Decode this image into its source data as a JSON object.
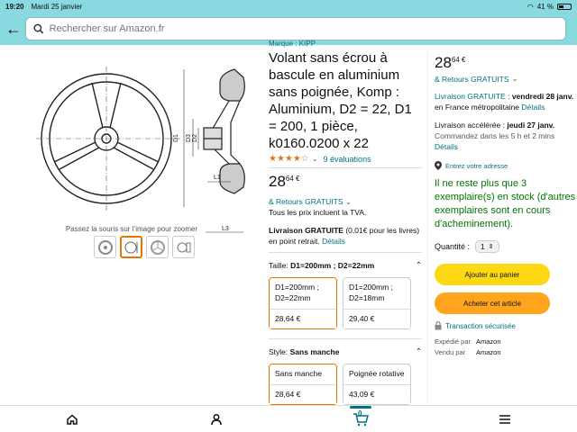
{
  "status": {
    "time": "19:20",
    "date": "Mardi 25 janvier",
    "battery": "41 %"
  },
  "search": {
    "placeholder": "Rechercher sur Amazon.fr"
  },
  "gallery": {
    "hint": "Passez la souris sur l’image pour zoomer",
    "drawing_labels": {
      "d1": "D1",
      "d2": "D2",
      "d3": "D3",
      "l1": "L1",
      "l3": "L3",
      "h7": "H7"
    }
  },
  "product": {
    "brand": "Marque : KIPP",
    "title": "Volant sans écrou à bascule en aluminium sans poignée, Komp : Aluminium, D2 = 22, D1 = 200, 1 pièce, k0160.0200 x 22",
    "rating_stars": "★★★★☆",
    "rating_count": "9 évaluations",
    "price_whole": "28",
    "price_fraction": "64 €",
    "returns": "& Retours GRATUITS",
    "tax_note": "Tous les prix incluent la TVA.",
    "delivery_strong": "Livraison GRATUITE",
    "delivery_rest": " (0,01€ pour les livres) en point retrait.",
    "delivery_link": "Détails",
    "size_label": "Taille:",
    "size_value": "D1=200mm ; D2=22mm",
    "size_options": [
      {
        "label": "D1=200mm ; D2=22mm",
        "price": "28,64 €"
      },
      {
        "label": "D1=200mm ; D2=18mm",
        "price": "29,40 €"
      }
    ],
    "style_label": "Style:",
    "style_value": "Sans manche",
    "style_options": [
      {
        "label": "Sans manche",
        "price": "28,64 €"
      },
      {
        "label": "Poignée rotative",
        "price": "43,09 €"
      }
    ]
  },
  "buybox": {
    "price_whole": "28",
    "price_fraction": "64 €",
    "returns": "& Retours GRATUITS",
    "delivery_free": "Livraison GRATUITE",
    "delivery_date": "vendredi 28 janv.",
    "delivery_where": "en France métropolitaine",
    "delivery_link": "Détails",
    "express_label": "Livraison accélérée :",
    "express_date": "jeudi 27 janv.",
    "express_order": "Commandez dans les 5 h et 2 mins",
    "express_link": "Détails",
    "address": "Entrez votre adresse",
    "stock": "Il ne reste plus que 3 exemplaire(s) en stock (d'autres exemplaires sont en cours d'acheminement).",
    "qty_label": "Quantité :",
    "qty_value": "1",
    "add_to_cart": "Ajouter au panier",
    "buy_now": "Acheter cet article",
    "secure": "Transaction sécurisée",
    "shipped_by_label": "Expédié par",
    "shipped_by": "Amazon",
    "sold_by_label": "Vendu par",
    "sold_by": "Amazon"
  },
  "nav": {
    "cart_count": "0"
  },
  "colors": {
    "header": "#88d9e0",
    "link": "#007185",
    "stock": "#007600",
    "cart_btn": "#ffd814",
    "buy_btn": "#ffa41c"
  }
}
